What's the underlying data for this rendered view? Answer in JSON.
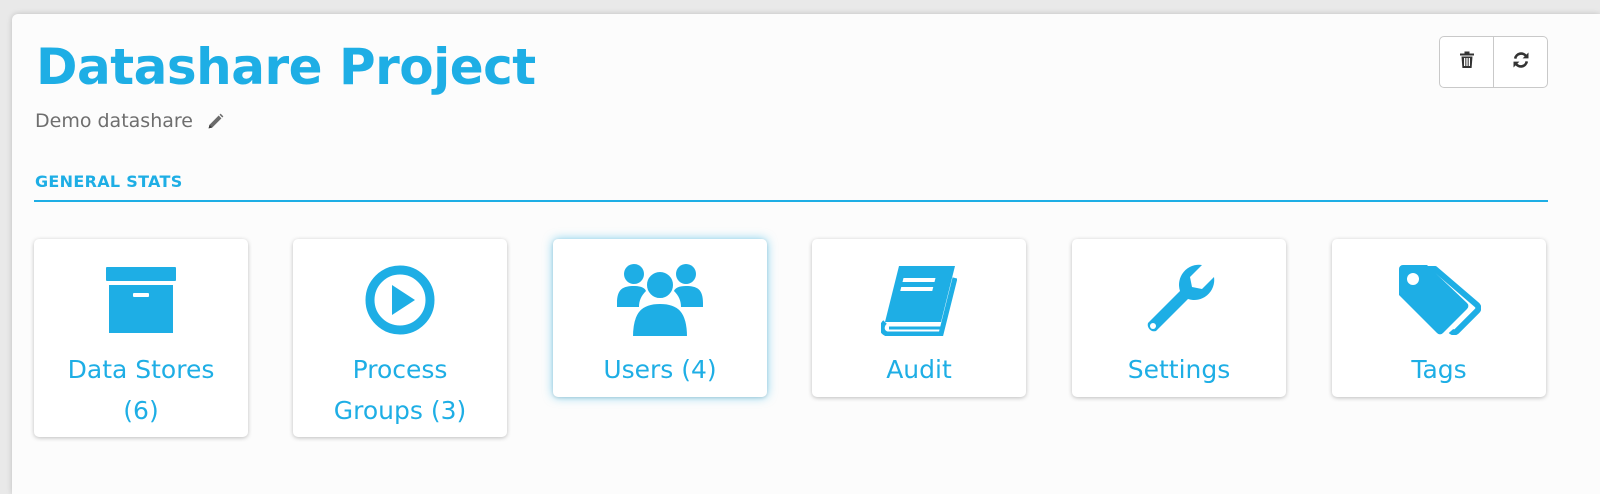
{
  "project": {
    "title": "Datashare Project",
    "description": "Demo datashare"
  },
  "toolbar": {
    "delete_icon": "trash-icon",
    "refresh_icon": "refresh-icon"
  },
  "section": {
    "title": "GENERAL STATS"
  },
  "tiles": [
    {
      "label": "Data Stores (6)",
      "icon": "archive-box-icon"
    },
    {
      "label": "Process Groups (3)",
      "icon": "play-circle-icon"
    },
    {
      "label": "Users (4)",
      "icon": "users-icon"
    },
    {
      "label": "Audit",
      "icon": "book-icon"
    },
    {
      "label": "Settings",
      "icon": "wrench-icon"
    },
    {
      "label": "Tags",
      "icon": "tags-icon"
    }
  ],
  "colors": {
    "accent": "#1eaee5",
    "subtitle": "#6e6e6e",
    "background": "#fcfcfc"
  }
}
